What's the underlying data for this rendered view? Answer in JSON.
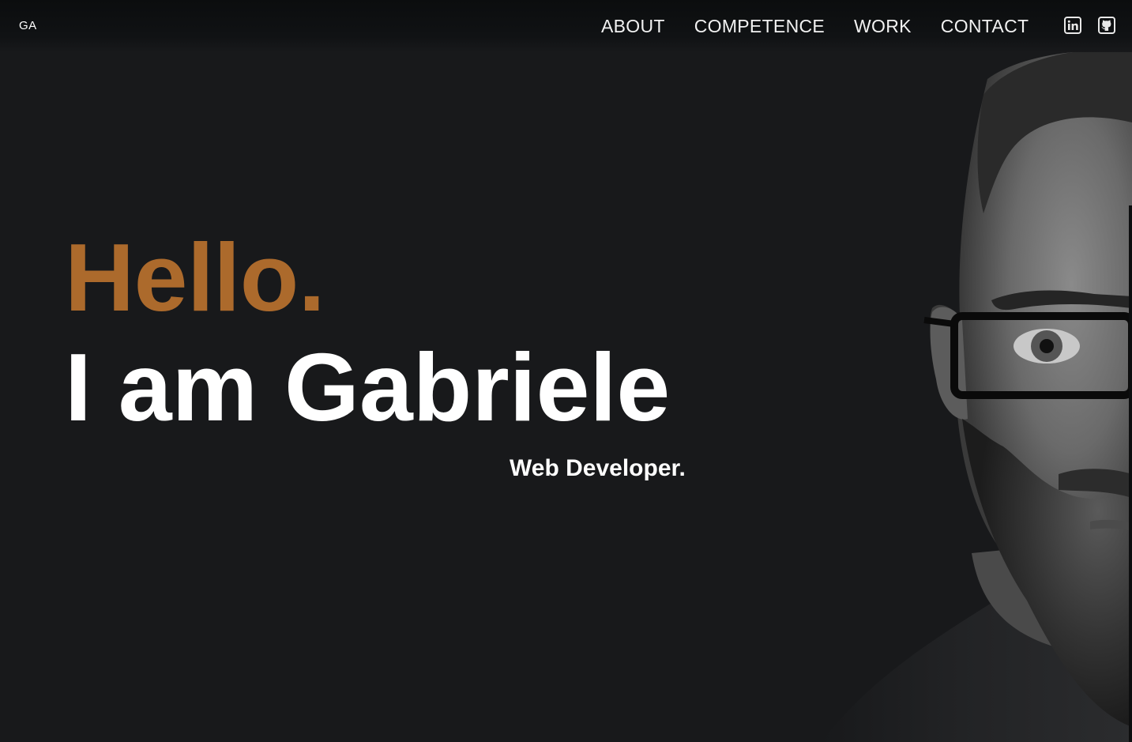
{
  "header": {
    "logo": "GA",
    "nav": [
      {
        "label": "ABOUT"
      },
      {
        "label": "COMPETENCE"
      },
      {
        "label": "WORK"
      },
      {
        "label": "CONTACT"
      }
    ],
    "social": [
      {
        "icon": "linkedin-icon"
      },
      {
        "icon": "github-icon"
      }
    ]
  },
  "hero": {
    "greeting": "Hello.",
    "name_line": "I am Gabriele",
    "role": "Web Developer."
  },
  "colors": {
    "background": "#18191b",
    "accent": "#ac6a2c",
    "text": "#ffffff"
  }
}
